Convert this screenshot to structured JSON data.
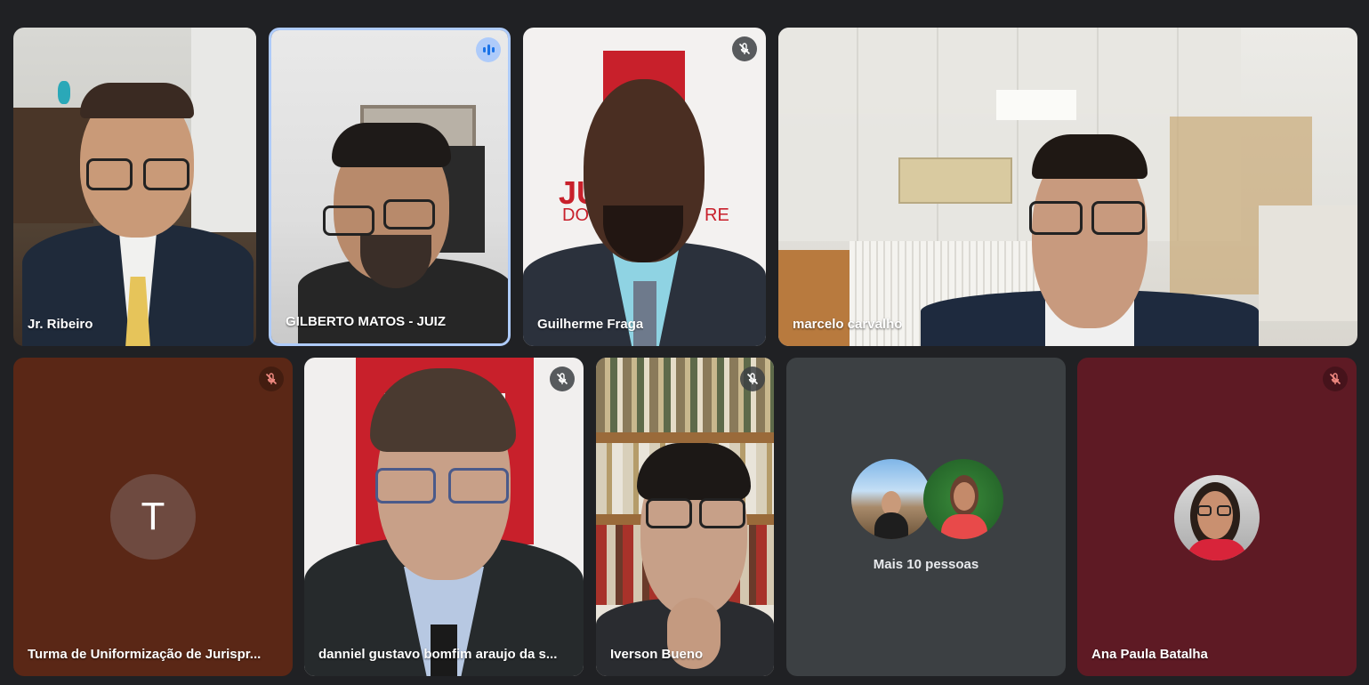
{
  "participants": [
    {
      "name": "Jr. Ribeiro",
      "muted": false
    },
    {
      "name": "GILBERTO MATOS - JUIZ",
      "speaking": true
    },
    {
      "name": "Guilherme Fraga",
      "muted": true
    },
    {
      "name": "marcelo carvalho",
      "muted": false
    },
    {
      "name": "Turma de Uniformização de Jurispr...",
      "muted": true,
      "avatar_letter": "T"
    },
    {
      "name": "danniel gustavo bomfim araujo da s...",
      "muted": true
    },
    {
      "name": "Iverson Bueno",
      "muted": true
    },
    {
      "name": "Ana Paula Batalha",
      "muted": true
    }
  ],
  "overflow": {
    "label": "Mais 10 pessoas"
  },
  "backdrop_text": {
    "logo_partial": "JU",
    "logo_sub": "DO",
    "logo_sub2": "RE"
  },
  "colors": {
    "background": "#202124",
    "speaking_border": "#aecbfa",
    "tile_turma": "#5a2716",
    "tile_ana": "#5e1a24",
    "tile_more": "#3c4043"
  },
  "icons": [
    "mic-off-icon",
    "speaking-indicator-icon"
  ]
}
